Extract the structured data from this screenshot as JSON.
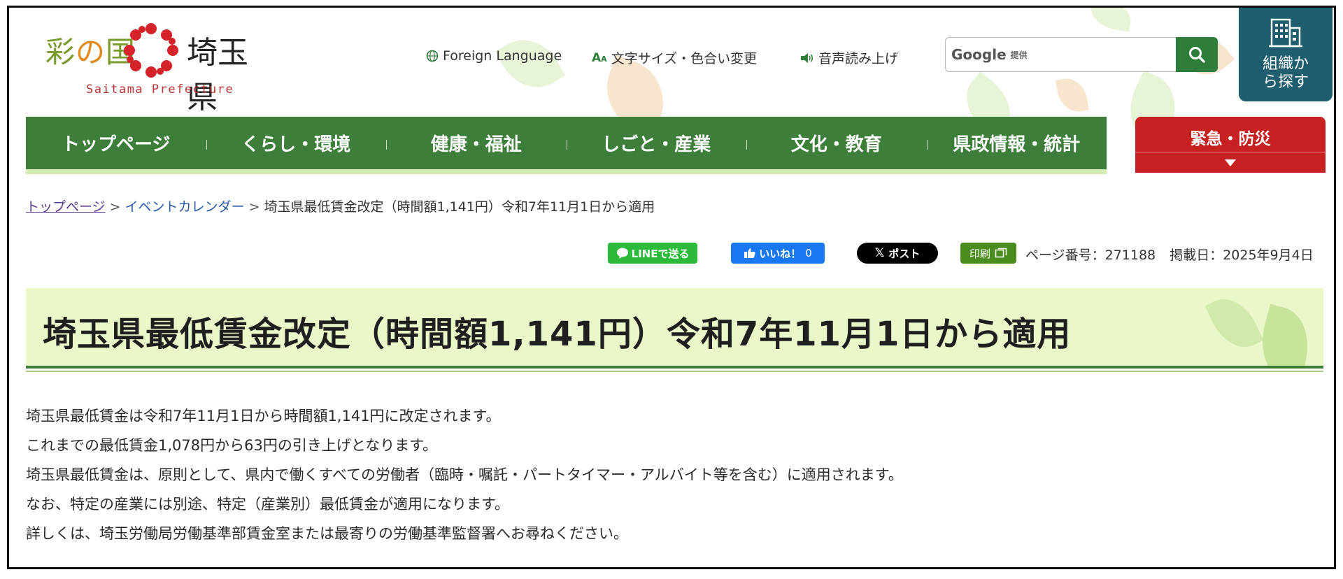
{
  "header": {
    "logo_left_1": "彩",
    "logo_left_no": "の",
    "logo_left_3": "国",
    "logo_right": "埼玉県",
    "logo_en": "Saitama Prefecture",
    "foreign_language": "Foreign Language",
    "text_size": "文字サイズ・色合い変更",
    "voice": "音声読み上げ",
    "search_brand": "Google",
    "search_provided": "提供",
    "org_search": "組織から探す"
  },
  "nav": {
    "items": [
      "トップページ",
      "くらし・環境",
      "健康・福祉",
      "しごと・産業",
      "文化・教育",
      "県政情報・統計"
    ],
    "emergency": "緊急・防災"
  },
  "breadcrumb": {
    "home": "トップページ",
    "events": "イベントカレンダー",
    "current": "埼玉県最低賃金改定（時間額1,141円）令和7年11月1日から適用",
    "separator": ">"
  },
  "share": {
    "line": "LINEで送る",
    "like": "いいね！",
    "like_count": "0",
    "post": "ポスト",
    "print": "印刷",
    "page_number_label": "ページ番号：271188",
    "published_label": "掲載日：2025年9月4日"
  },
  "page": {
    "title": "埼玉県最低賃金改定（時間額1,141円）令和7年11月1日から適用",
    "paragraphs": [
      "埼玉県最低賃金は令和7年11月1日から時間額1,141円に改定されます。",
      "これまでの最低賃金1,078円から63円の引き上げとなります。",
      "埼玉県最低賃金は、原則として、県内で働くすべての労働者（臨時・嘱託・パートタイマー・アルバイト等を含む）に適用されます。",
      "なお、特定の産業には別途、特定（産業別）最低賃金が適用になります。",
      "詳しくは、埼玉労働局労働基準部賃金室または最寄りの労働基準監督署へお尋ねください。"
    ]
  },
  "colors": {
    "nav_green": "#3d7f3a",
    "emergency_red": "#c62020",
    "org_teal": "#1f5e6e",
    "title_bg": "#eaf7c9"
  }
}
